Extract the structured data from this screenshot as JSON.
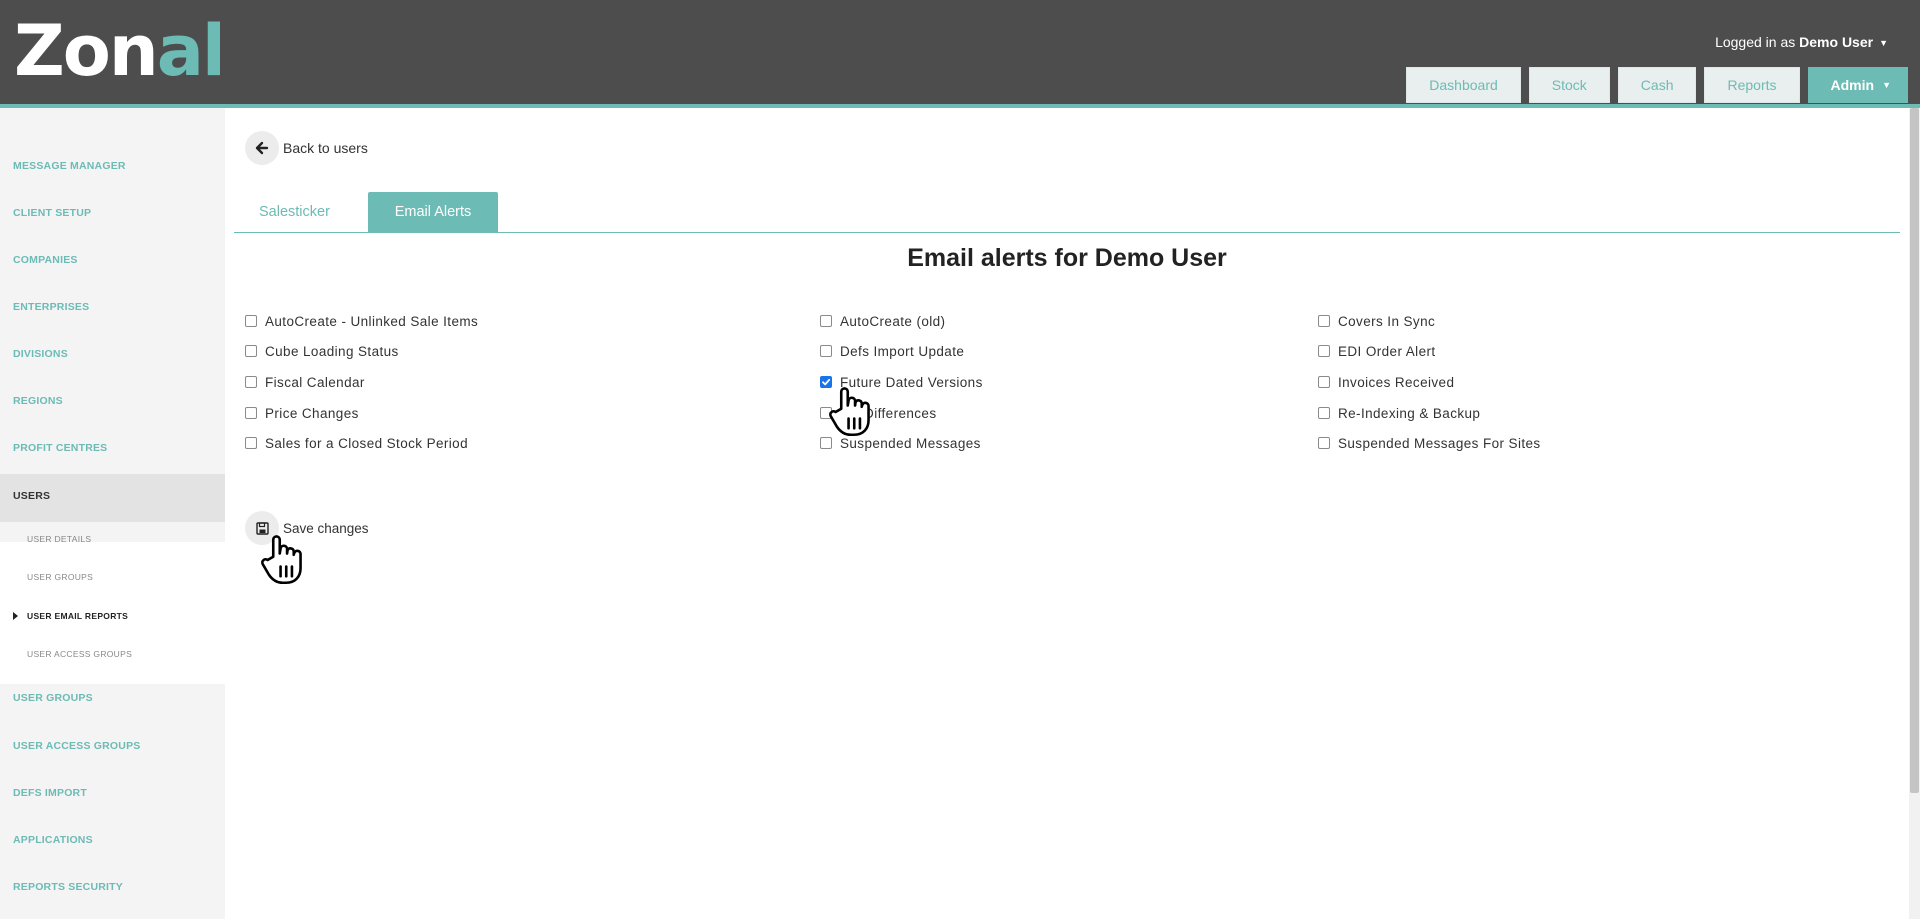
{
  "brand": {
    "logo_main": "Zon",
    "logo_accent": "al"
  },
  "header": {
    "logged_in_prefix": "Logged in as",
    "user_name": "Demo User",
    "nav": [
      {
        "label": "Dashboard"
      },
      {
        "label": "Stock"
      },
      {
        "label": "Cash"
      },
      {
        "label": "Reports"
      },
      {
        "label": "Admin"
      }
    ]
  },
  "sidebar": {
    "items": [
      {
        "label": "MESSAGE MANAGER"
      },
      {
        "label": "CLIENT SETUP"
      },
      {
        "label": "COMPANIES"
      },
      {
        "label": "ENTERPRISES"
      },
      {
        "label": "DIVISIONS"
      },
      {
        "label": "REGIONS"
      },
      {
        "label": "PROFIT CENTRES"
      },
      {
        "label": "USERS"
      },
      {
        "label": "USER GROUPS"
      },
      {
        "label": "USER ACCESS GROUPS"
      },
      {
        "label": "DEFS IMPORT"
      },
      {
        "label": "APPLICATIONS"
      },
      {
        "label": "REPORTS SECURITY"
      }
    ],
    "subitems": [
      {
        "label": "USER DETAILS"
      },
      {
        "label": "USER GROUPS"
      },
      {
        "label": "USER EMAIL REPORTS"
      },
      {
        "label": "USER ACCESS GROUPS"
      }
    ],
    "active_item": "USERS",
    "current_subitem": "USER EMAIL REPORTS"
  },
  "main": {
    "back_label": "Back to users",
    "tabs": [
      {
        "label": "Salesticker"
      },
      {
        "label": "Email Alerts"
      }
    ],
    "active_tab": "Email Alerts",
    "title": "Email alerts for Demo User",
    "alerts": [
      {
        "label": "AutoCreate - Unlinked Sale Items",
        "checked": false
      },
      {
        "label": "AutoCreate (old)",
        "checked": false
      },
      {
        "label": "Covers In Sync",
        "checked": false
      },
      {
        "label": "Cube Loading Status",
        "checked": false
      },
      {
        "label": "Defs Import Update",
        "checked": false
      },
      {
        "label": "EDI Order Alert",
        "checked": false
      },
      {
        "label": "Fiscal Calendar",
        "checked": false
      },
      {
        "label": "Future Dated Versions",
        "checked": true
      },
      {
        "label": "Invoices Received",
        "checked": false
      },
      {
        "label": "Price Changes",
        "checked": false
      },
      {
        "label": "e Differences",
        "checked": false
      },
      {
        "label": "Re-Indexing & Backup",
        "checked": false
      },
      {
        "label": "Sales for a Closed Stock Period",
        "checked": false
      },
      {
        "label": "Suspended Messages",
        "checked": false
      },
      {
        "label": "Suspended Messages For Sites",
        "checked": false
      }
    ],
    "save_label": "Save changes"
  },
  "colors": {
    "accent": "#6cbbb5",
    "header_bg": "#4d4d4d",
    "checkbox_checked": "#1a73e8"
  }
}
